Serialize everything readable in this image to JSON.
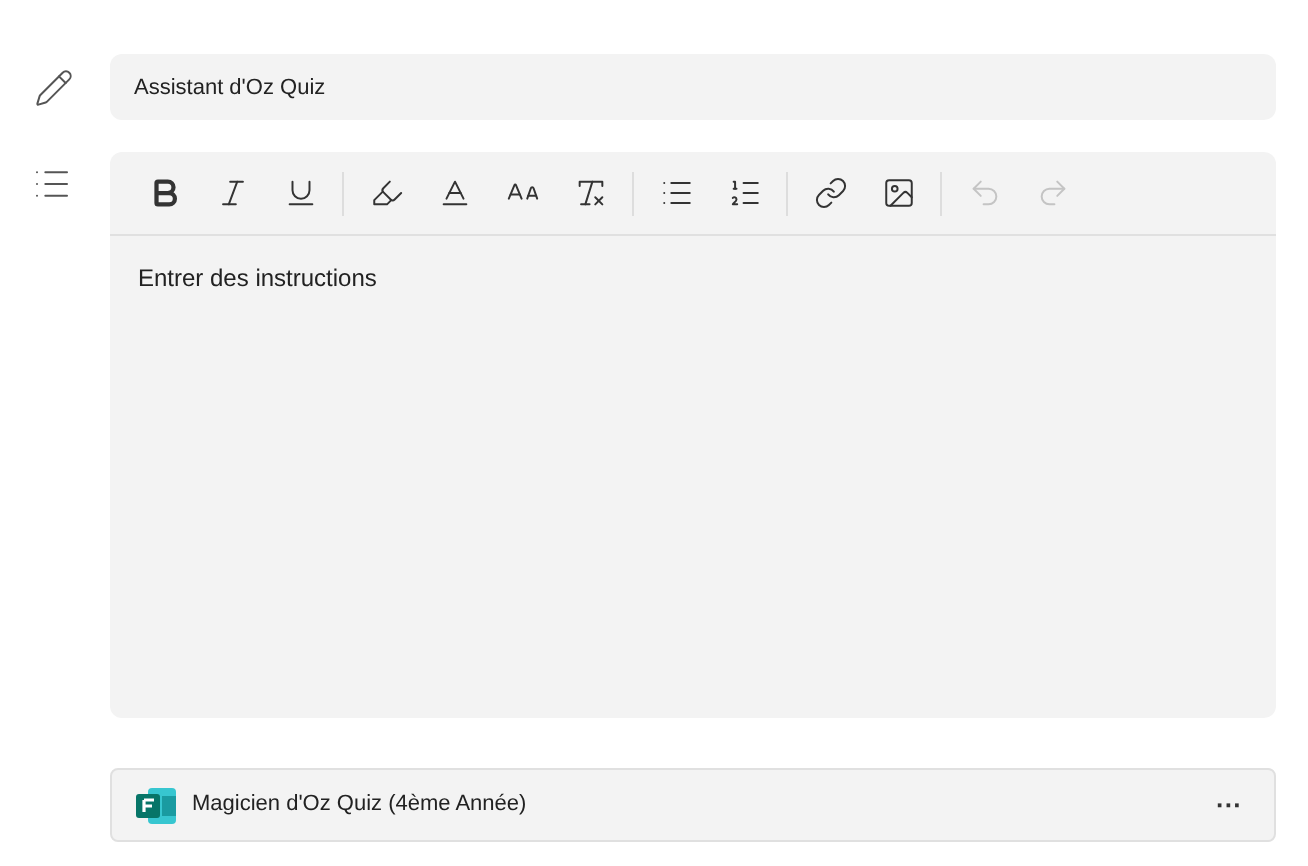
{
  "title_field": {
    "value": "Assistant d'Oz Quiz"
  },
  "toolbar": {
    "groups": [
      [
        {
          "kind": "bold",
          "disabled": false
        },
        {
          "kind": "italic",
          "disabled": false
        },
        {
          "kind": "underline",
          "disabled": false
        }
      ],
      [
        {
          "kind": "highlight",
          "disabled": false
        },
        {
          "kind": "font-color",
          "disabled": false
        },
        {
          "kind": "font-size",
          "disabled": false
        },
        {
          "kind": "clear-format",
          "disabled": false
        }
      ],
      [
        {
          "kind": "bullets",
          "disabled": false
        },
        {
          "kind": "numbering",
          "disabled": false
        }
      ],
      [
        {
          "kind": "link",
          "disabled": false
        },
        {
          "kind": "image",
          "disabled": false
        }
      ],
      [
        {
          "kind": "undo",
          "disabled": true
        },
        {
          "kind": "redo",
          "disabled": true
        }
      ]
    ]
  },
  "editor": {
    "placeholder": "Entrer des instructions"
  },
  "attachment": {
    "name": "Magicien d'Oz Quiz (4ème Année)",
    "more": "···"
  }
}
